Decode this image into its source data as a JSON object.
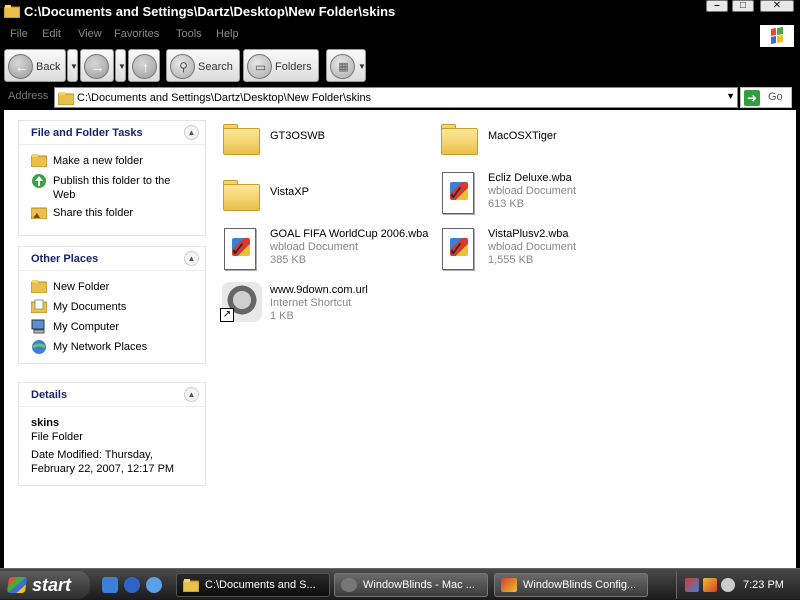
{
  "window": {
    "title": "C:\\Documents and Settings\\Dartz\\Desktop\\New Folder\\skins"
  },
  "menu": [
    "File",
    "Edit",
    "View",
    "Favorites",
    "Tools",
    "Help"
  ],
  "toolbar": {
    "back": "Back",
    "search": "Search",
    "folders": "Folders"
  },
  "address": {
    "label": "Address",
    "value": "C:\\Documents and Settings\\Dartz\\Desktop\\New Folder\\skins",
    "go": "Go"
  },
  "panels": {
    "tasks": {
      "title": "File and Folder Tasks",
      "items": [
        "Make a new folder",
        "Publish this folder to the",
        "Web",
        "Share this folder"
      ]
    },
    "places": {
      "title": "Other Places",
      "items": [
        "New Folder",
        "My Documents",
        "My Computer",
        "My Network Places"
      ]
    },
    "details": {
      "title": "Details",
      "name": "skins",
      "type": "File Folder",
      "modified_1": "Date Modified: Thursday,",
      "modified_2": "February 22, 2007, 12:17 PM"
    }
  },
  "files": [
    {
      "name": "GT3OSWB",
      "type": "",
      "size": "",
      "icon": "folder-icon"
    },
    {
      "name": "MacOSXTiger",
      "type": "",
      "size": "",
      "icon": "folder-icon"
    },
    {
      "name": "VistaXP",
      "type": "",
      "size": "",
      "icon": "folder-icon"
    },
    {
      "name": "Ecliz Deluxe.wba",
      "type": "wbload Document",
      "size": "613 KB",
      "icon": "wba-document-icon"
    },
    {
      "name": "GOAL FIFA WorldCup 2006.wba",
      "type": "wbload Document",
      "size": "385 KB",
      "icon": "wba-document-icon"
    },
    {
      "name": "VistaPlusv2.wba",
      "type": "wbload Document",
      "size": "1,555 KB",
      "icon": "wba-document-icon"
    },
    {
      "name": "www.9down.com.url",
      "type": "Internet Shortcut",
      "size": "1 KB",
      "icon": "raccoon-shortcut-icon"
    }
  ],
  "taskbar": {
    "start": "start",
    "tasks": [
      "C:\\Documents and S...",
      "WindowBlinds - Mac ...",
      "WindowBlinds Config..."
    ],
    "clock": "7:23 PM"
  }
}
